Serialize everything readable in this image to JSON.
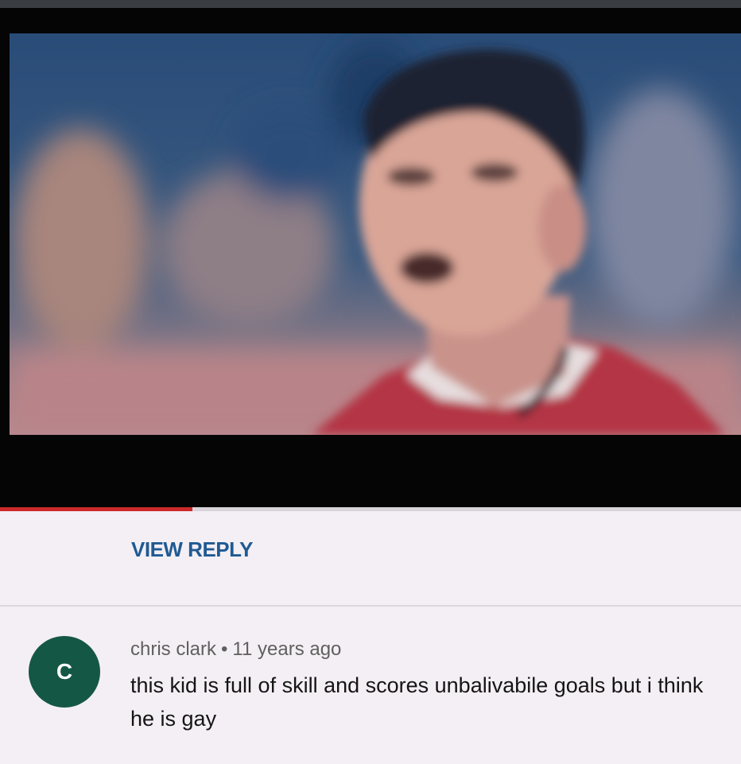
{
  "video": {
    "progress_fraction": 0.26,
    "colors": {
      "background": "#050505",
      "progress": "#cc2a2a"
    }
  },
  "replies": {
    "view_reply_label": "VIEW REPLY"
  },
  "comment": {
    "avatar_letter": "C",
    "avatar_color": "#155745",
    "author": "chris clark",
    "separator": "•",
    "time": "11 years ago",
    "text": "this kid is full of skill and scores unbalivabile goals but i think he is gay"
  }
}
